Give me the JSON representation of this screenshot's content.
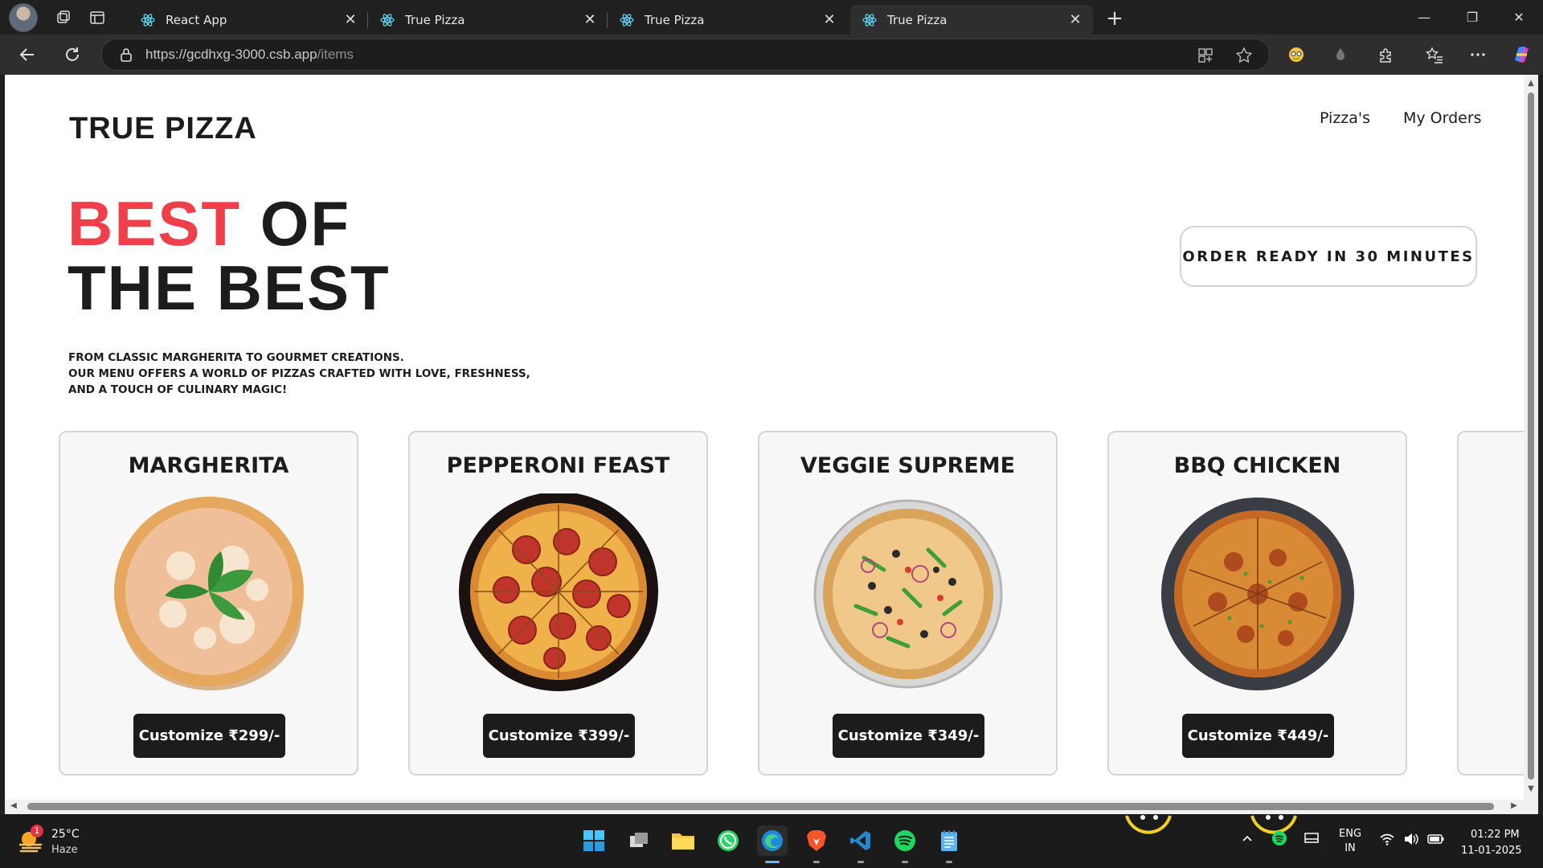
{
  "browser": {
    "tabs": [
      {
        "title": "React App"
      },
      {
        "title": "True Pizza"
      },
      {
        "title": "True Pizza"
      },
      {
        "title": "True Pizza"
      }
    ],
    "url_host": "https://gcdhxg-3000.csb.app",
    "url_path": "/items",
    "window_controls": {
      "minimize": "—",
      "restore": "❐",
      "close": "✕"
    }
  },
  "site": {
    "brand": "TRUE PIZZA",
    "nav": [
      "Pizza's",
      "My Orders"
    ],
    "hero": {
      "accent": "BEST",
      "line1_rest": " OF",
      "line2": "THE BEST"
    },
    "badge": "ORDER READY IN 30 MINUTES",
    "tagline": [
      "From classic Margherita to gourmet creations.",
      "Our menu offers a world of pizzas crafted with love, freshness,",
      "and a touch of culinary magic!"
    ],
    "accent_color": "#ee3f4b",
    "pizzas": [
      {
        "name": "MARGHERITA",
        "button": "Customize ₹299/-"
      },
      {
        "name": "PEPPERONI FEAST",
        "button": "Customize ₹399/-"
      },
      {
        "name": "VEGGIE SUPREME",
        "button": "Customize ₹349/-"
      },
      {
        "name": "BBQ CHICKEN",
        "button": "Customize ₹449/-"
      }
    ]
  },
  "taskbar": {
    "weather": {
      "badge": "1",
      "temp": "25°C",
      "condition": "Haze"
    },
    "language": {
      "line1": "ENG",
      "line2": "IN"
    },
    "clock": {
      "time": "01:22 PM",
      "date": "11-01-2025"
    },
    "apps": [
      "start-icon",
      "task-view-icon",
      "file-explorer-icon",
      "whatsapp-icon",
      "edge-icon",
      "brave-icon",
      "vscode-icon",
      "spotify-icon",
      "notepad-icon"
    ]
  }
}
